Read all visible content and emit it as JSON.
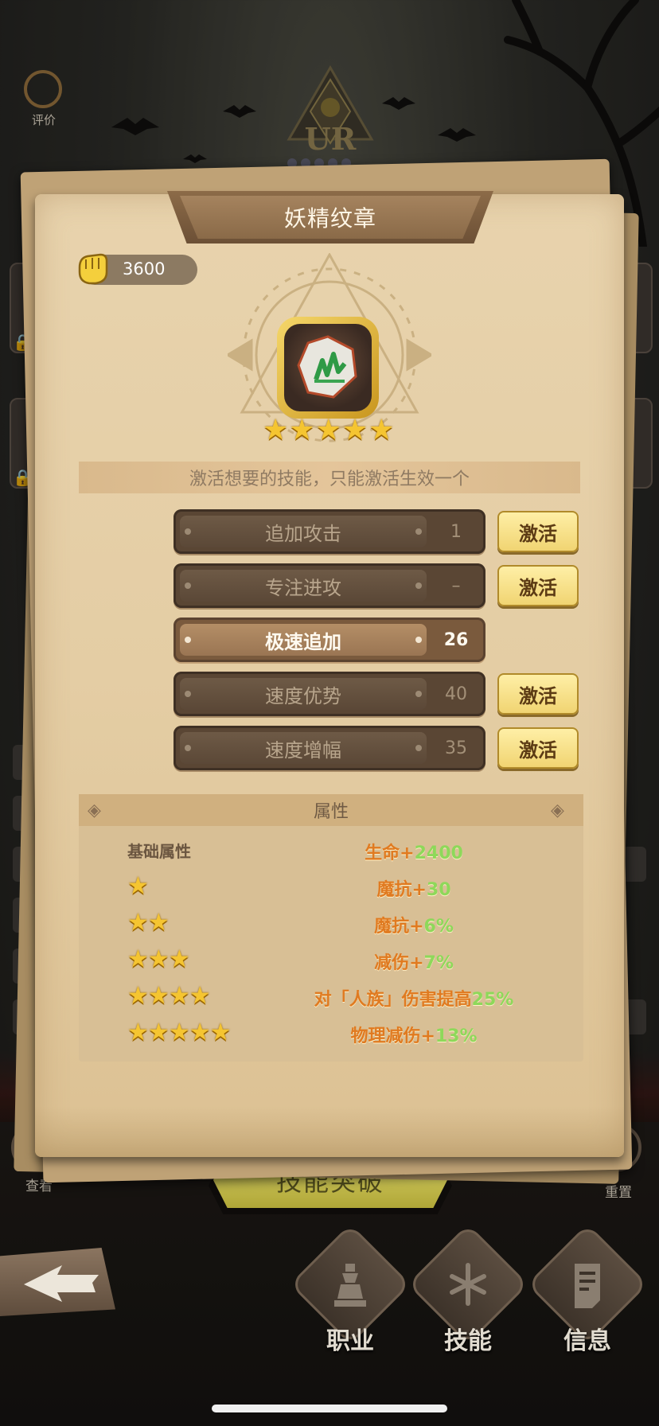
{
  "top": {
    "rate_label": "评价",
    "rank_badge": "UR"
  },
  "panel": {
    "title": "妖精纹章",
    "power_value": "3600",
    "item_icon": "green-crystal-emblem-icon",
    "item_star_count": 5,
    "hint": "激活想要的技能，只能激活生效一个"
  },
  "skills": [
    {
      "name": "追加攻击",
      "level": "1",
      "active": false,
      "button": "激活"
    },
    {
      "name": "专注进攻",
      "level": "–",
      "active": false,
      "button": "激活"
    },
    {
      "name": "极速追加",
      "level": "26",
      "active": true,
      "button": ""
    },
    {
      "name": "速度优势",
      "level": "40",
      "active": false,
      "button": "激活"
    },
    {
      "name": "速度增幅",
      "level": "35",
      "active": false,
      "button": "激活"
    }
  ],
  "attributes": {
    "header": "属性",
    "rows": [
      {
        "label": "基础属性",
        "stars": 0,
        "value_text": "生命+",
        "value_num": "2400"
      },
      {
        "label": "",
        "stars": 1,
        "value_text": "魔抗+",
        "value_num": "30"
      },
      {
        "label": "",
        "stars": 2,
        "value_text": "魔抗+",
        "value_num": "6%"
      },
      {
        "label": "",
        "stars": 3,
        "value_text": "减伤+",
        "value_num": "7%"
      },
      {
        "label": "",
        "stars": 4,
        "value_text": "对「人族」伤害提高",
        "value_num": "25%"
      },
      {
        "label": "",
        "stars": 5,
        "value_text": "物理减伤+",
        "value_num": "13%"
      }
    ]
  },
  "actions": {
    "break_button": "技能突破",
    "view_label": "查看",
    "reset_label": "重置"
  },
  "nav": {
    "back_icon": "back-arrow-icon",
    "items": [
      {
        "label": "职业",
        "icon": "class-piece-icon"
      },
      {
        "label": "技能",
        "icon": "skill-sigil-icon"
      },
      {
        "label": "信息",
        "icon": "info-document-icon"
      }
    ]
  },
  "colors": {
    "panel_bg": "#e6cfa6",
    "activate_btn": "#f5dd84",
    "attr_value": "#e07a20",
    "attr_num": "#8ed85a",
    "star": "#f5c531"
  }
}
